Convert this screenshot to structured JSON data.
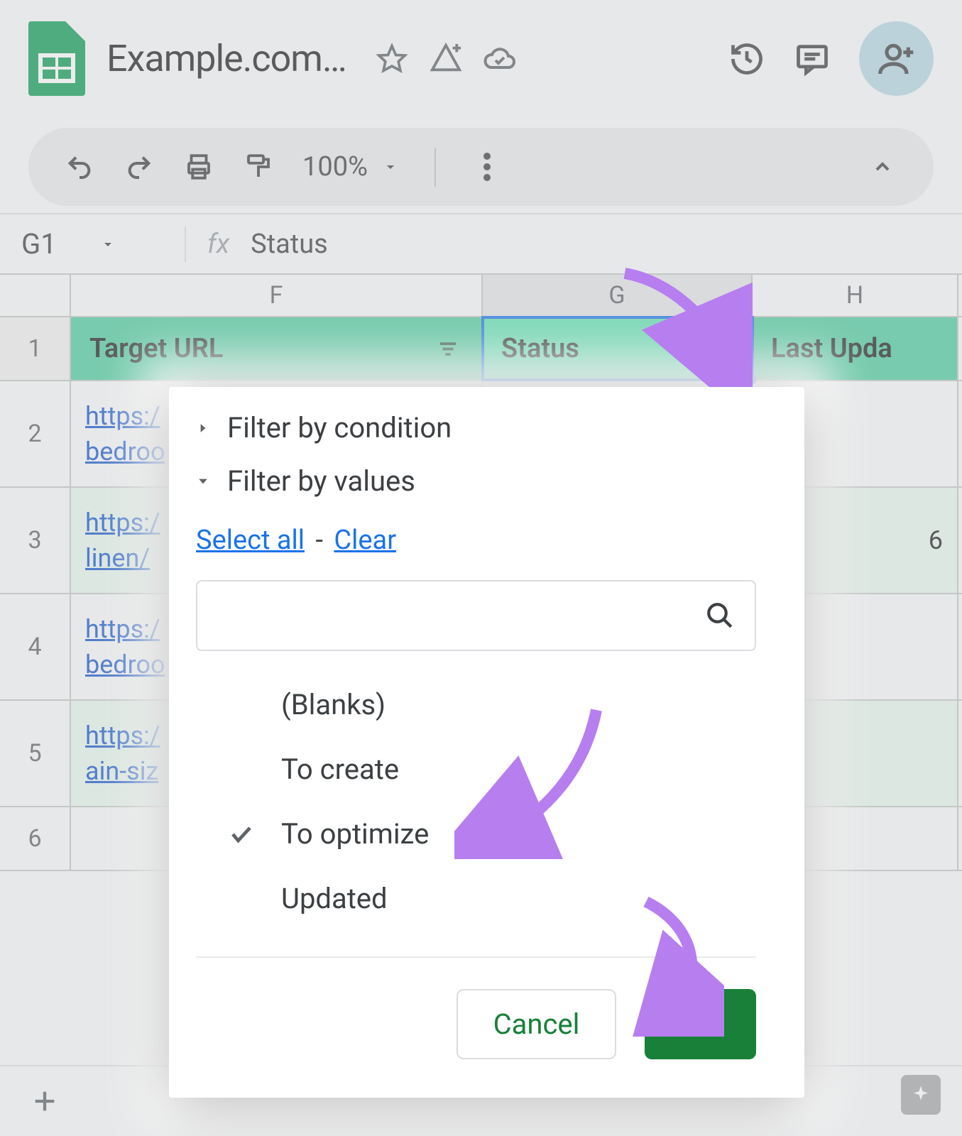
{
  "header": {
    "doc_title": "Example.com…",
    "icons": {
      "star": "star-icon",
      "addons": "addons-icon",
      "cloud": "cloud-saved-icon",
      "history": "history-icon",
      "comments": "comments-icon",
      "share": "share-person-icon"
    }
  },
  "toolbar": {
    "zoom": "100%"
  },
  "formula_bar": {
    "cell_ref": "G1",
    "fx": "fx",
    "value": "Status"
  },
  "columns": [
    "F",
    "G",
    "H"
  ],
  "header_cells": {
    "F": "Target URL",
    "G": "Status",
    "H": "Last Upda"
  },
  "rows": [
    {
      "num": "2",
      "F": "https:/\nbedroo",
      "G": "",
      "H": ""
    },
    {
      "num": "3",
      "F": "https:/\nlinen/",
      "G": "",
      "H": "6"
    },
    {
      "num": "4",
      "F": "https:/\nbedroo",
      "G": "",
      "H": ""
    },
    {
      "num": "5",
      "F": "https:/\nain-siz",
      "G": "",
      "H": ""
    },
    {
      "num": "6",
      "F": "",
      "G": "",
      "H": ""
    }
  ],
  "popup": {
    "condition_label": "Filter by condition",
    "values_label": "Filter by values",
    "select_all": "Select all",
    "clear": "Clear",
    "search_placeholder": "",
    "value_options": [
      {
        "label": "(Blanks)",
        "checked": false
      },
      {
        "label": "To create",
        "checked": false
      },
      {
        "label": "To optimize",
        "checked": true
      },
      {
        "label": "Updated",
        "checked": false
      }
    ],
    "cancel": "Cancel",
    "ok": "OK"
  }
}
